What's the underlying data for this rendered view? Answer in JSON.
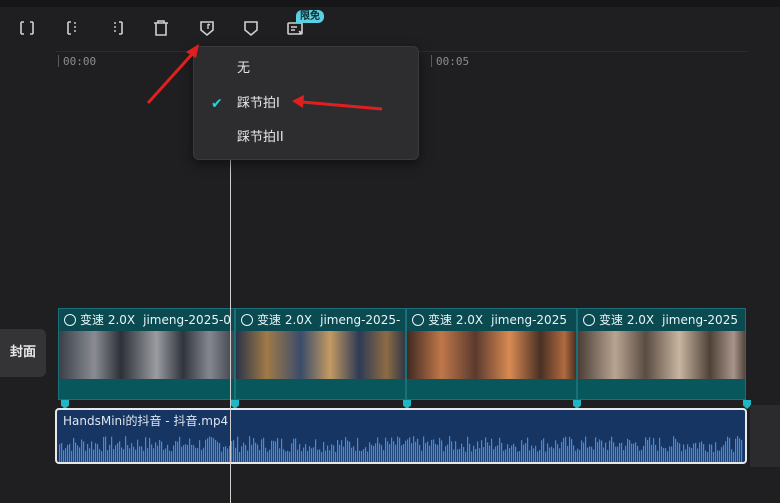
{
  "toolbar": {
    "buttons": [
      {
        "name": "split-icon"
      },
      {
        "name": "trim-left-icon"
      },
      {
        "name": "trim-right-icon"
      },
      {
        "name": "delete-icon"
      },
      {
        "name": "beat-marker-icon"
      },
      {
        "name": "marker-icon"
      },
      {
        "name": "ai-edit-icon"
      }
    ],
    "badge": "限免"
  },
  "ruler": {
    "labels": [
      "00:00",
      "00:05"
    ]
  },
  "menu": {
    "items": [
      {
        "label": "无",
        "checked": false
      },
      {
        "label": "踩节拍I",
        "checked": true
      },
      {
        "label": "踩节拍II",
        "checked": false
      }
    ],
    "check_mark": "✔"
  },
  "cover": {
    "label": "封面"
  },
  "video_clips": [
    {
      "speed": "变速 2.0X",
      "name": "jimeng-2025-0"
    },
    {
      "speed": "变速 2.0X",
      "name": "jimeng-2025-"
    },
    {
      "speed": "变速 2.0X",
      "name": "jimeng-2025"
    },
    {
      "speed": "变速 2.0X",
      "name": "jimeng-2025"
    }
  ],
  "audio": {
    "name": "HandsMini的抖音 - 抖音.mp4"
  },
  "colors": {
    "accent": "#1fb7c4",
    "clip": "#0e5a60",
    "audio": "#173563",
    "annotation": "#e02020"
  }
}
